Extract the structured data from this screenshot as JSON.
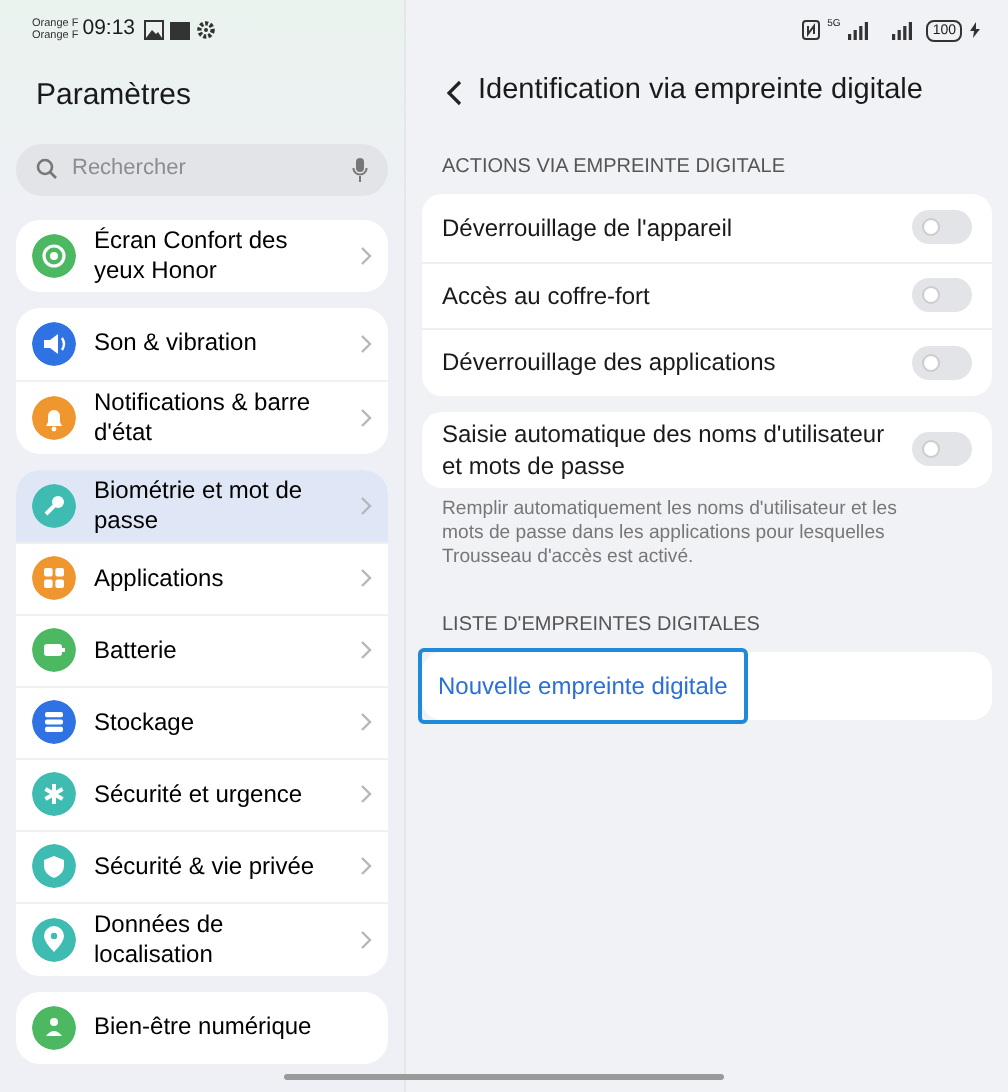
{
  "status_bar": {
    "carriers": [
      "Orange F",
      "Orange F"
    ],
    "time": "09:13",
    "network": "5G",
    "battery": "100"
  },
  "sidebar": {
    "title": "Paramètres",
    "search": {
      "placeholder": "Rechercher"
    },
    "groups": [
      {
        "items": [
          {
            "label": "Écran Confort des yeux Honor",
            "color": "#4cb862",
            "selected": false
          }
        ]
      },
      {
        "items": [
          {
            "label": "Son & vibration",
            "color": "#2f72e4",
            "selected": false
          },
          {
            "label": "Notifications & barre d'état",
            "color": "#f0962f",
            "selected": false
          }
        ]
      },
      {
        "items": [
          {
            "label": "Biométrie et mot de passe",
            "color": "#3ebcb2",
            "selected": true
          },
          {
            "label": "Applications",
            "color": "#f0962f",
            "selected": false
          },
          {
            "label": "Batterie",
            "color": "#4cb862",
            "selected": false
          },
          {
            "label": "Stockage",
            "color": "#2f72e4",
            "selected": false
          },
          {
            "label": "Sécurité et urgence",
            "color": "#3ebcb2",
            "selected": false
          },
          {
            "label": "Sécurité & vie privée",
            "color": "#3ebcb2",
            "selected": false
          },
          {
            "label": "Données de localisation",
            "color": "#3ebcb2",
            "selected": false
          }
        ]
      },
      {
        "items": [
          {
            "label": "Bien-être numérique",
            "color": "#4cb862",
            "selected": false
          }
        ]
      }
    ]
  },
  "detail": {
    "title": "Identification via empreinte digitale",
    "sections": [
      {
        "heading": "ACTIONS VIA EMPREINTE DIGITALE",
        "cards": [
          {
            "rows": [
              {
                "label": "Déverrouillage de l'appareil",
                "on": false
              },
              {
                "label": "Accès au coffre-fort",
                "on": false
              },
              {
                "label": "Déverrouillage des applications",
                "on": false
              }
            ]
          },
          {
            "rows": [
              {
                "label": "Saisie automatique des noms d'utilisateur et mots de passe",
                "on": false
              }
            ],
            "note": "Remplir automatiquement les noms d'utilisateur et les mots de passe dans les applications pour lesquelles Trousseau d'accès est activé."
          }
        ]
      },
      {
        "heading": "LISTE D'EMPREINTES DIGITALES",
        "link": {
          "label": "Nouvelle empreinte digitale",
          "focused": true
        }
      }
    ]
  }
}
